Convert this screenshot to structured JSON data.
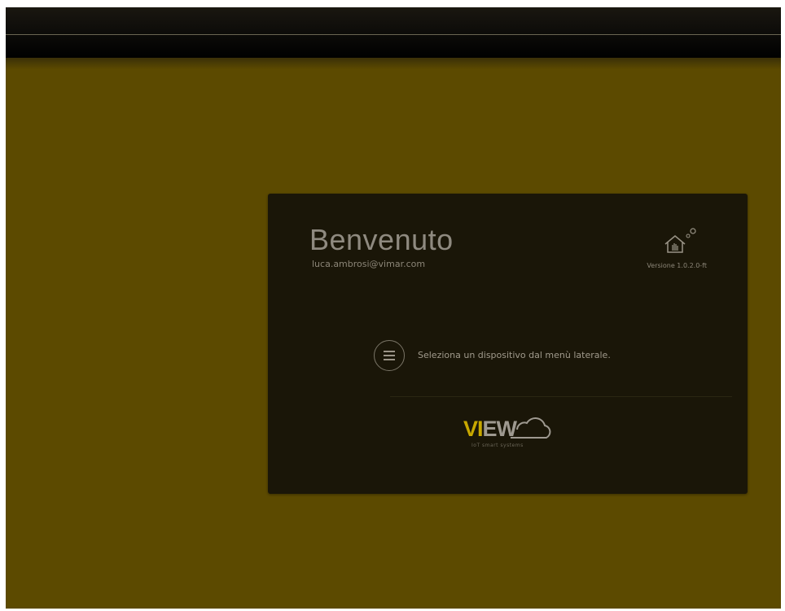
{
  "card": {
    "welcome": "Benvenuto",
    "email": "luca.ambrosi@vimar.com",
    "version": "Versione 1.0.2.0-ft",
    "instruction": "Seleziona un dispositivo dal menù laterale."
  },
  "logo": {
    "text_part1": "VI",
    "text_part2": "EW",
    "tagline": "IoT smart systems"
  },
  "icons": {
    "menu": "hamburger-menu-icon",
    "brand": "home-hand-gear-icon",
    "logo": "cloud-icon"
  },
  "colors": {
    "background": "#5c4a00",
    "card": "#1a1608",
    "accent": "#c8a800"
  }
}
